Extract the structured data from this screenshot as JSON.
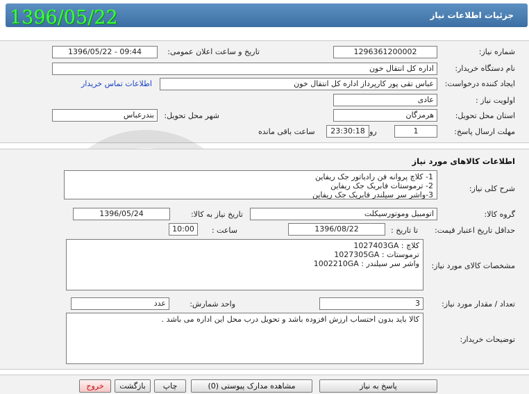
{
  "header": {
    "title": "جزئیات اطلاعات نیاز",
    "date_stamp": "1396/05/22"
  },
  "info": {
    "need_number_label": "شماره نیاز:",
    "need_number": "1296361200002",
    "announce_label": "تاریخ و ساعت اعلان عمومی:",
    "announce_value": "1396/05/22 - 09:44",
    "buyer_label": "نام دستگاه خریدار:",
    "buyer_value": "اداره کل انتقال خون",
    "creator_label": "ایجاد کننده درخواست:",
    "creator_value": "عباس تقی پور کارپرداز اداره کل انتقال خون",
    "contact_link": "اطلاعات تماس خریدار",
    "priority_label": "اولویت نیاز :",
    "priority_value": "عادی",
    "province_label": "استان محل تحویل:",
    "province_value": "هرمزگان",
    "city_label": "شهر محل تحویل:",
    "city_value": "بندرعباس",
    "deadline_label": "مهلت ارسال پاسخ:",
    "deadline_days": "1",
    "days_word": "روز و",
    "deadline_time": "23:30:18",
    "remaining_text": "ساعت باقی مانده"
  },
  "goods": {
    "section_title": "اطلاعات کالاهای مورد نیاز",
    "summary_label": "شرح کلی نیاز:",
    "summary_lines": [
      "1- کلاچ پروانه فن رادیاتور جک ریفاین",
      "2- ترموستات فابریک جک ریفاین",
      "3-واشر سر سیلندر فابریک جک ریفاین"
    ],
    "group_label": "گروه کالا:",
    "group_value": "اتومبیل وموتورسیکلت",
    "need_date_label": "تاریخ نیاز به کالا:",
    "need_date_value": "1396/05/24",
    "validity_label": "حداقل تاریخ اعتبار قیمت:",
    "until_date_label": "تا تاریخ :",
    "until_date_value": "1396/08/22",
    "time_label": "ساعت :",
    "time_value": "10:00",
    "specs_label": "مشخصات کالای مورد نیاز:",
    "specs_lines": [
      "کلاچ : 1027403GA",
      "ترموستات : 1027305GA",
      "واشر سر سیلندر : 1002210GA"
    ],
    "qty_label": "تعداد / مقدار مورد نیاز:",
    "qty_value": "3",
    "unit_label": "واحد شمارش:",
    "unit_value": "عدد",
    "desc_label": "توضیحات خریدار:",
    "desc_value": "کالا باید بدون احتساب ارزش افزوده باشد و تحویل درب محل این اداره می باشد ."
  },
  "footer": {
    "reply_button": "پاسخ به نیاز",
    "attachments_button": "مشاهده مدارک پیوستی (0)",
    "print_button": "چاپ",
    "back_button": "بازگشت",
    "exit_button": "خروج"
  },
  "colors": {
    "header_bg": "#4a7fb5",
    "date_stamp": "#3cff3c",
    "link": "#1a44c8",
    "exit_text": "#c01010"
  }
}
